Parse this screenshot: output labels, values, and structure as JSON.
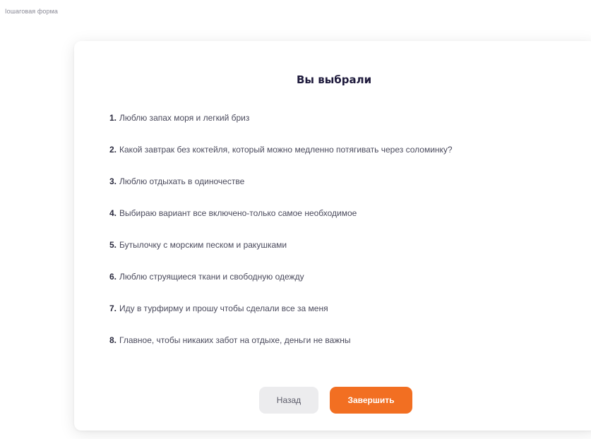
{
  "page": {
    "corner_label": "Iошаговая форма"
  },
  "card": {
    "title": "Вы выбрали",
    "answers": [
      {
        "num": "1.",
        "text": "Люблю запах моря и легкий бриз"
      },
      {
        "num": "2.",
        "text": "Какой завтрак без коктейля, который можно медленно потягивать через соломинку?"
      },
      {
        "num": "3.",
        "text": "Люблю отдыхать в одиночестве"
      },
      {
        "num": "4.",
        "text": "Выбираю вариант все включено-только самое необходимое"
      },
      {
        "num": "5.",
        "text": "Бутылочку с морским песком и ракушками"
      },
      {
        "num": "6.",
        "text": "Люблю струящиеся ткани и свободную одежду"
      },
      {
        "num": "7.",
        "text": "Иду в турфирму и прошу чтобы сделали все за меня"
      },
      {
        "num": "8.",
        "text": "Главное, чтобы никаких забот на отдыхе, деньги не важны"
      }
    ],
    "back_label": "Назад",
    "finish_label": "Завершить"
  },
  "colors": {
    "accent": "#f26f22",
    "title": "#1e1a3c",
    "secondary_button": "#ececee"
  }
}
